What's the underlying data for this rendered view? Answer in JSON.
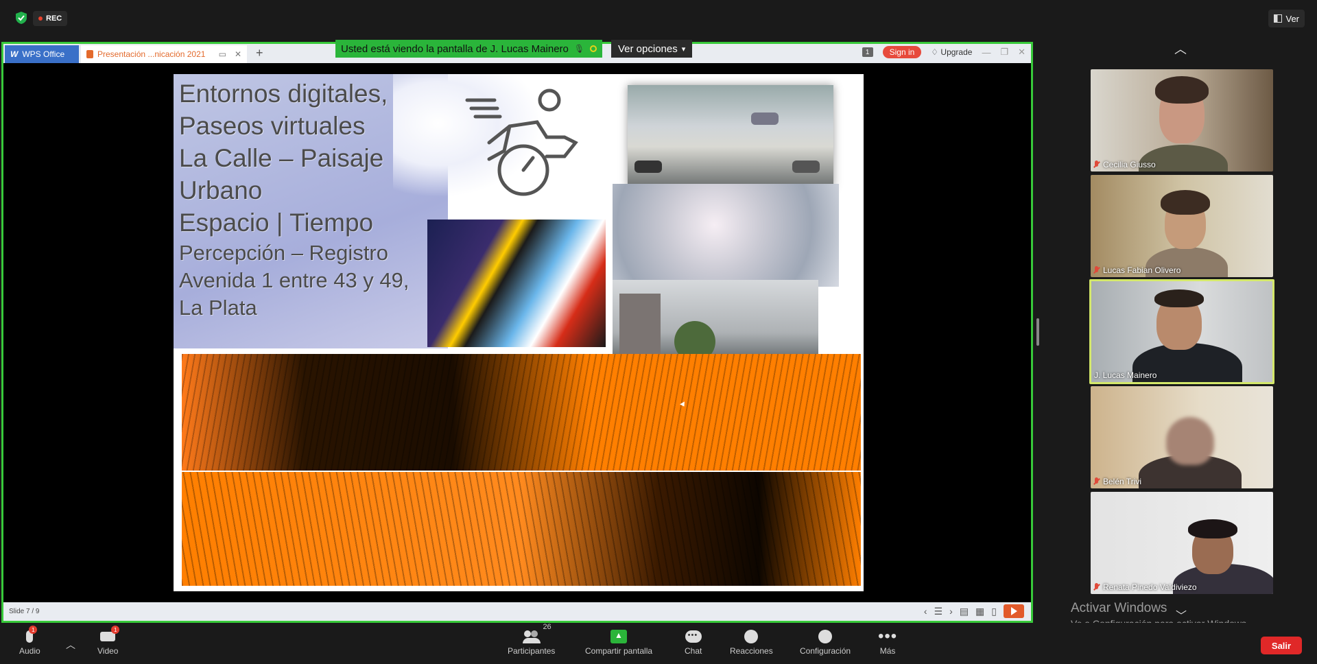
{
  "top": {
    "rec_label": "REC",
    "view_label": "Ver"
  },
  "wps": {
    "home_tab": "WPS Office",
    "doc_tab": "Presentación ...nicación 2021",
    "sign_in": "Sign in",
    "upgrade": "Upgrade",
    "page_badge": "1"
  },
  "banner": {
    "viewing": "Usted está viendo la pantalla de J. Lucas Mainero",
    "options": "Ver opciones"
  },
  "slide": {
    "title_lines": [
      "Entornos digitales,",
      "Paseos virtuales",
      "La Calle – Paisaje",
      "Urbano",
      "Espacio | Tiempo",
      "Percepción – Registro",
      "Avenida 1 entre 43 y 49,",
      "La Plata"
    ],
    "counter": "Slide 7 / 9"
  },
  "participants": [
    {
      "name": "Cecilia Giusso",
      "muted": true
    },
    {
      "name": "Lucas Fabian Olivero",
      "muted": true
    },
    {
      "name": "J. Lucas Mainero",
      "muted": false,
      "active": true
    },
    {
      "name": "Belén Trivi",
      "muted": true
    },
    {
      "name": "Renata Pinedo Valdiviezo",
      "muted": true
    }
  ],
  "watermark": {
    "title": "Activar Windows",
    "subtitle": "Ve a Configuración para activar Windows."
  },
  "toolbar": {
    "audio": "Audio",
    "video": "Video",
    "participants": "Participantes",
    "participants_count": "26",
    "share": "Compartir pantalla",
    "chat": "Chat",
    "reactions": "Reacciones",
    "settings": "Configuración",
    "more": "Más",
    "leave": "Salir",
    "alert_count": "1"
  },
  "colors": {
    "share_border": "#38c93a",
    "leave": "#e02828",
    "active_speaker": "#d4e86a"
  }
}
